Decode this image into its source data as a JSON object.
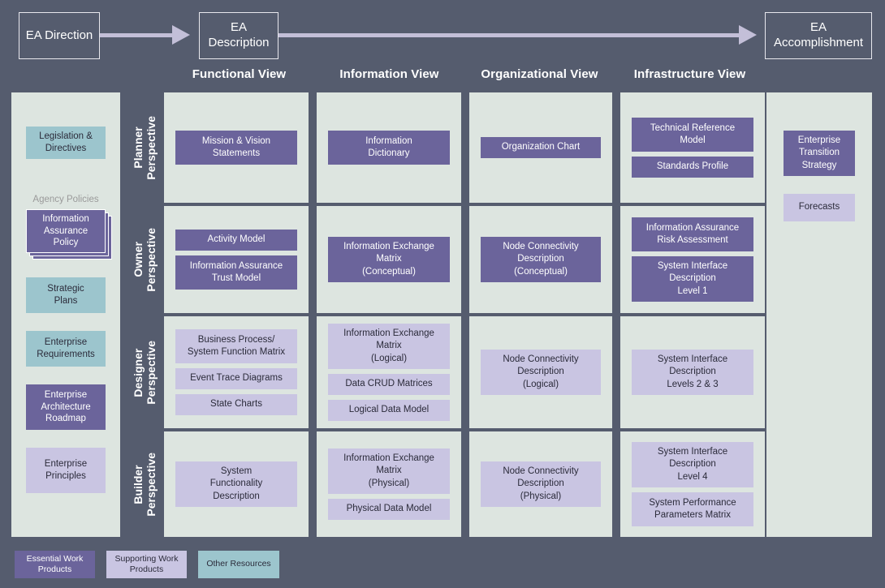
{
  "colors": {
    "background": "#555c6e",
    "panel": "#dde5e0",
    "essential_purple": "#6b649b",
    "supporting_lilac": "#c9c5e2",
    "other_teal": "#9cc5cd",
    "arrow": "#c3bfd8",
    "label_gray": "#9a9a9a"
  },
  "flow": {
    "direction": "EA\nDirection",
    "description": "EA\nDescription",
    "accomplishment": "EA\nAccomplishment"
  },
  "column_headers": [
    "Functional View",
    "Information View",
    "Organizational View",
    "Infrastructure View"
  ],
  "perspectives": [
    "Planner\nPerspective",
    "Owner\nPerspective",
    "Designer\nPerspective",
    "Builder\nPerspective"
  ],
  "left_panel": {
    "items": [
      {
        "label": "Legislation &\nDirectives",
        "type": "other"
      },
      {
        "label": "Agency Policies",
        "type": "caption"
      },
      {
        "label": "Information\nAssurance\nPolicy",
        "type": "essential-stacked"
      },
      {
        "label": "Strategic\nPlans",
        "type": "other"
      },
      {
        "label": "Enterprise\nRequirements",
        "type": "other"
      },
      {
        "label": "Enterprise\nArchitecture\nRoadmap",
        "type": "essential"
      },
      {
        "label": "Enterprise\nPrinciples",
        "type": "supporting"
      }
    ]
  },
  "right_panel": {
    "items": [
      {
        "label": "Enterprise\nTransition\nStrategy",
        "type": "essential"
      },
      {
        "label": "Forecasts",
        "type": "supporting"
      }
    ]
  },
  "grid": {
    "rows": [
      {
        "perspective": "Planner Perspective",
        "cells": [
          {
            "view": "Functional View",
            "items": [
              {
                "label": "Mission & Vision\nStatements",
                "type": "essential"
              }
            ]
          },
          {
            "view": "Information View",
            "items": [
              {
                "label": "Information\nDictionary",
                "type": "essential"
              }
            ]
          },
          {
            "view": "Organizational View",
            "items": [
              {
                "label": "Organization Chart",
                "type": "essential"
              }
            ]
          },
          {
            "view": "Infrastructure View",
            "items": [
              {
                "label": "Technical Reference\nModel",
                "type": "essential"
              },
              {
                "label": "Standards Profile",
                "type": "essential"
              }
            ]
          }
        ]
      },
      {
        "perspective": "Owner Perspective",
        "cells": [
          {
            "view": "Functional View",
            "items": [
              {
                "label": "Activity Model",
                "type": "essential"
              },
              {
                "label": "Information Assurance\nTrust Model",
                "type": "essential"
              }
            ]
          },
          {
            "view": "Information View",
            "items": [
              {
                "label": "Information Exchange\nMatrix\n(Conceptual)",
                "type": "essential"
              }
            ]
          },
          {
            "view": "Organizational View",
            "items": [
              {
                "label": "Node Connectivity\nDescription\n(Conceptual)",
                "type": "essential"
              }
            ]
          },
          {
            "view": "Infrastructure View",
            "items": [
              {
                "label": "Information Assurance\nRisk Assessment",
                "type": "essential"
              },
              {
                "label": "System Interface\nDescription\nLevel 1",
                "type": "essential"
              }
            ]
          }
        ]
      },
      {
        "perspective": "Designer Perspective",
        "cells": [
          {
            "view": "Functional View",
            "items": [
              {
                "label": "Business Process/\nSystem Function Matrix",
                "type": "supporting"
              },
              {
                "label": "Event Trace Diagrams",
                "type": "supporting"
              },
              {
                "label": "State Charts",
                "type": "supporting"
              }
            ]
          },
          {
            "view": "Information View",
            "items": [
              {
                "label": "Information Exchange\nMatrix\n(Logical)",
                "type": "supporting"
              },
              {
                "label": "Data CRUD Matrices",
                "type": "supporting"
              },
              {
                "label": "Logical Data Model",
                "type": "supporting"
              }
            ]
          },
          {
            "view": "Organizational View",
            "items": [
              {
                "label": "Node Connectivity\nDescription\n(Logical)",
                "type": "supporting"
              }
            ]
          },
          {
            "view": "Infrastructure View",
            "items": [
              {
                "label": "System Interface\nDescription\nLevels 2 & 3",
                "type": "supporting"
              }
            ]
          }
        ]
      },
      {
        "perspective": "Builder Perspective",
        "cells": [
          {
            "view": "Functional View",
            "items": [
              {
                "label": "System\nFunctionality\nDescription",
                "type": "supporting"
              }
            ]
          },
          {
            "view": "Information View",
            "items": [
              {
                "label": "Information Exchange\nMatrix\n(Physical)",
                "type": "supporting"
              },
              {
                "label": "Physical Data Model",
                "type": "supporting"
              }
            ]
          },
          {
            "view": "Organizational View",
            "items": [
              {
                "label": "Node Connectivity\nDescription\n(Physical)",
                "type": "supporting"
              }
            ]
          },
          {
            "view": "Infrastructure View",
            "items": [
              {
                "label": "System Interface\nDescription\nLevel 4",
                "type": "supporting"
              },
              {
                "label": "System Performance\nParameters Matrix",
                "type": "supporting"
              }
            ]
          }
        ]
      }
    ]
  },
  "legend": [
    {
      "label": "Essential Work\nProducts",
      "type": "essential"
    },
    {
      "label": "Supporting Work\nProducts",
      "type": "supporting"
    },
    {
      "label": "Other Resources",
      "type": "other"
    }
  ]
}
